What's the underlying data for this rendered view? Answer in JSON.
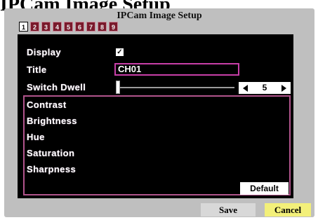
{
  "page_heading": "IPCam Image Setup",
  "panel": {
    "title": "IPCam Image Setup"
  },
  "tabs": [
    {
      "label": "1",
      "active": true
    },
    {
      "label": "2",
      "active": false
    },
    {
      "label": "3",
      "active": false
    },
    {
      "label": "4",
      "active": false
    },
    {
      "label": "5",
      "active": false
    },
    {
      "label": "6",
      "active": false
    },
    {
      "label": "7",
      "active": false
    },
    {
      "label": "8",
      "active": false
    },
    {
      "label": "9",
      "active": false
    }
  ],
  "display": {
    "label": "Display",
    "checked": true,
    "check_glyph": "✓"
  },
  "title_field": {
    "label": "Title",
    "value": "CH01"
  },
  "switch_dwell": {
    "label": "Switch Dwell",
    "value": "5",
    "slider_fraction": 0.0
  },
  "image_settings": [
    "Contrast",
    "Brightness",
    "Hue",
    "Saturation",
    "Sharpness"
  ],
  "buttons": {
    "default": "Default",
    "save": "Save",
    "cancel": "Cancel"
  },
  "colors": {
    "accent": "#c83fa8",
    "tab": "#7a1a2c",
    "cancel": "#f3f07a"
  }
}
